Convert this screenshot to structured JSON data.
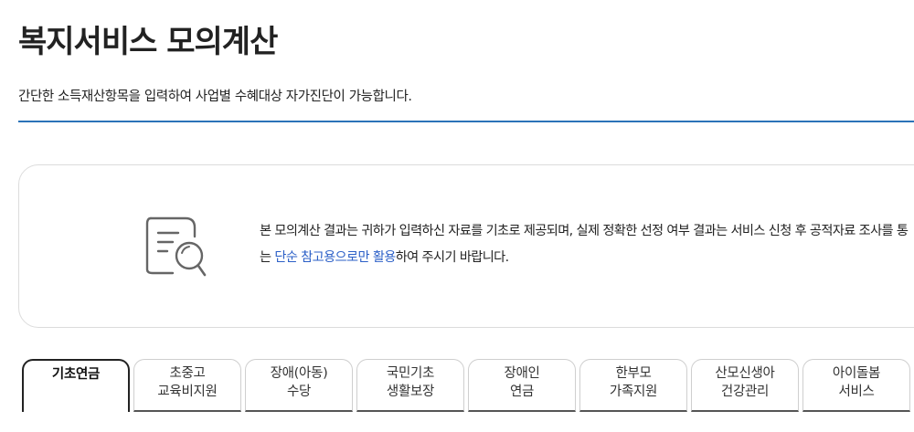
{
  "header": {
    "title": "복지서비스 모의계산",
    "description": "간단한 소득재산항목을 입력하여 사업별 수혜대상 자가진단이 가능합니다."
  },
  "notice": {
    "icon": "document-search-icon",
    "line1": "본 모의계산 결과는 귀하가 입력하신 자료를 기초로 제공되며, 실제 정확한 선정 여부 결과는 서비스 신청 후 공적자료 조사를 통",
    "line2_prefix": "는 ",
    "line2_highlight": "단순 참고용으로만 활용",
    "line2_suffix": "하여 주시기 바랍니다."
  },
  "tabs": [
    {
      "line1": "기초연금",
      "line2": "",
      "active": true
    },
    {
      "line1": "초중고",
      "line2": "교육비지원",
      "active": false
    },
    {
      "line1": "장애(아동)",
      "line2": "수당",
      "active": false
    },
    {
      "line1": "국민기초",
      "line2": "생활보장",
      "active": false
    },
    {
      "line1": "장애인",
      "line2": "연금",
      "active": false
    },
    {
      "line1": "한부모",
      "line2": "가족지원",
      "active": false
    },
    {
      "line1": "산모신생아",
      "line2": "건강관리",
      "active": false
    },
    {
      "line1": "아이돌봄",
      "line2": "서비스",
      "active": false
    }
  ],
  "colors": {
    "accent": "#2b73b8",
    "highlight": "#2b5fc7",
    "text": "#222222",
    "border": "#dcdcdc"
  }
}
